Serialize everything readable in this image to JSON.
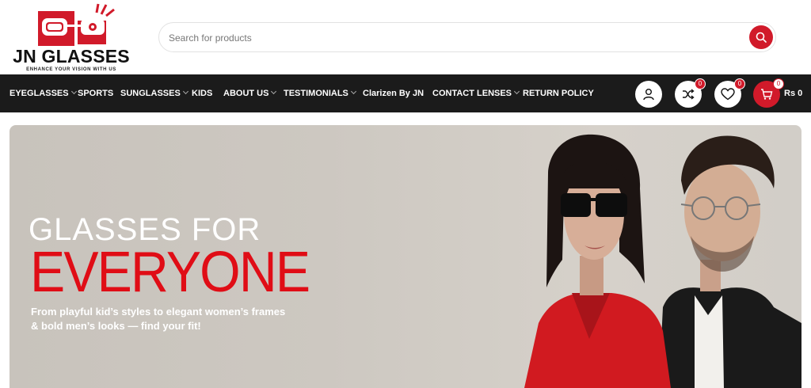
{
  "brand": {
    "name": "JN GLASSES",
    "tagline": "ENHANCE YOUR VISION WITH US",
    "accent_color": "#d11a2a"
  },
  "search": {
    "placeholder": "Search for products",
    "icon": "search-icon"
  },
  "nav": {
    "items": [
      {
        "label": "EYEGLASSES",
        "has_dropdown": true
      },
      {
        "label": "SPORTS",
        "has_dropdown": false
      },
      {
        "label": "SUNGLASSES",
        "has_dropdown": true
      },
      {
        "label": "KIDS",
        "has_dropdown": false
      },
      {
        "label": "ABOUT US",
        "has_dropdown": true
      },
      {
        "label": "TESTIMONIALS",
        "has_dropdown": true
      },
      {
        "label": "Clarizen By JN",
        "has_dropdown": false
      },
      {
        "label": "CONTACT LENSES",
        "has_dropdown": true
      },
      {
        "label": "RETURN POLICY",
        "has_dropdown": false
      }
    ]
  },
  "header_icons": {
    "account": "user-icon",
    "compare": {
      "icon": "shuffle-icon",
      "count": "0"
    },
    "wishlist": {
      "icon": "heart-icon",
      "count": "0"
    },
    "cart": {
      "icon": "cart-icon",
      "count": "0",
      "total": "Rs 0"
    }
  },
  "hero": {
    "title_line1": "GLASSES FOR",
    "title_line2": "EVERYONE",
    "subtitle": "From playful kid’s styles to elegant women’s frames & bold men’s looks — find your fit!",
    "title_color": "#e00d16"
  }
}
